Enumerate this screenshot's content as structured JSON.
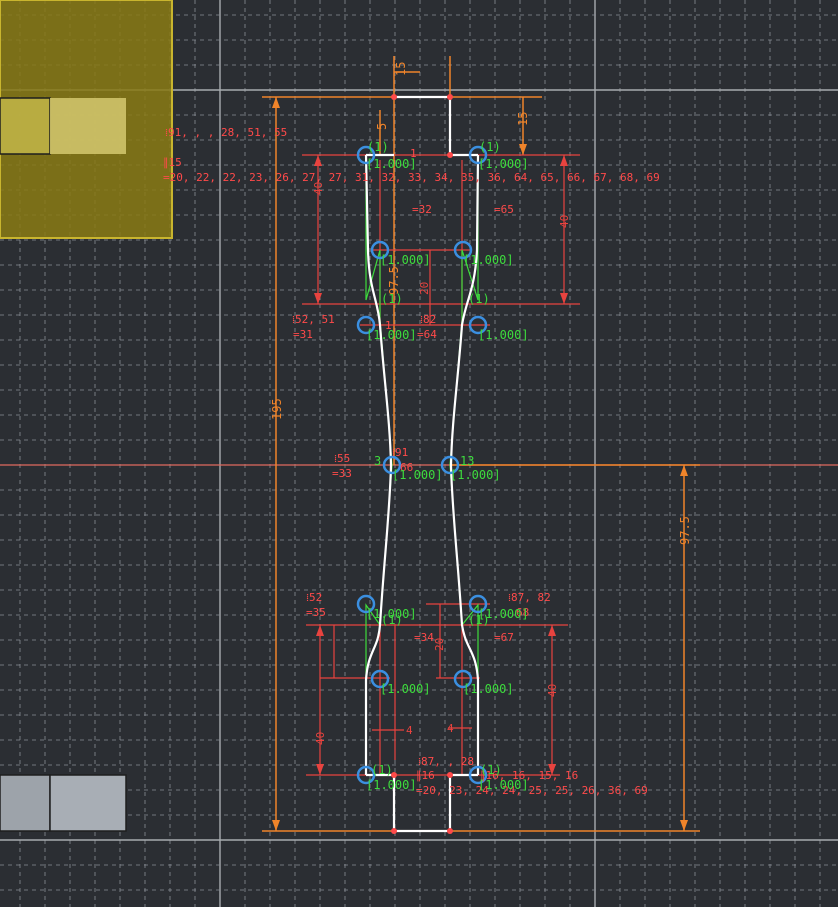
{
  "colors": {
    "background": "#2b2e33",
    "grid_minor": "#8a8f96",
    "grid_major": "#a7abb0",
    "axis_horizontal": "#e06a5e",
    "construction_orange": "#f0842a",
    "dimension_red": "#e8433f",
    "constraint_text": "#ff4a4a",
    "profile_white": "#ffffff",
    "spline_green": "#3ddc3d",
    "control_point_blue": "#3b8fe0",
    "selected_face": "#c9b52e",
    "block_grey": "#9da3aa"
  },
  "dimensions": {
    "top_offset": "15",
    "top_gap": "15",
    "total_height": "195",
    "half_height": "97.5",
    "left_inner_height": "97.5",
    "upper_left_40": "40",
    "upper_right_40": "40",
    "upper_mid_20": "20",
    "lower_left_40": "40",
    "lower_right_40": "40",
    "lower_mid_20": "20",
    "small_5": "5",
    "small_4_left": "4",
    "small_4_right": "4"
  },
  "constraints": {
    "c1_line1": "⁞91, , , 28, 51, 55",
    "c1_line2": "∥15",
    "c1_line3": "=20, 22, 22, 23, 26, 27, 27, 31, 32, 33, 34, 35, 36, 64, 65, 66, 67, 68, 69",
    "c_eq32": "=32",
    "c_eq65": "=65",
    "c_52_51": "⁞52, 51",
    "c_eq31": "=31",
    "c_82": "⁞82",
    "c_eq64": "=64",
    "c_55": "⁞55",
    "c_eq33": "=33",
    "c_91": "⁞91",
    "c_3": "3",
    "c_66": "66",
    "c_13": "13",
    "c_52": "⁞52",
    "c_eq35": "=35",
    "c_87_82": "⁞87, 82",
    "c_68": "68",
    "c_eq34": "=34",
    "c_eq67": "=67",
    "c_87_28": "⁞87, , 28",
    "c_16": "∥16",
    "c_16_list": "∥16, 16, 15, 16",
    "c_bottom_list": "=20, 23, 24, 24, 25, 25, 26, 36, 69",
    "c_1": "1",
    "c_1b": "1"
  },
  "weights": {
    "w1": "[1.000]",
    "w2": "[1.000]",
    "w3": "[1.000]",
    "w4": "[1.000]",
    "w5": "[1.000]",
    "w6": "[1.000]",
    "w7": "[1.000]",
    "w8": "[1.000]",
    "w9": "[1.000]",
    "w10": "[1.000]",
    "w11": "[1.000]",
    "w12": "[1.000]",
    "w13": "[1.000]",
    "w14": "[1.000]"
  },
  "point_tags": {
    "p1": "(1)",
    "p2": "(1)",
    "p3": "(1)",
    "p4": "(1)",
    "p5": "(1)",
    "p6": "(1)",
    "p7": "(1)",
    "p8": "(1)"
  }
}
